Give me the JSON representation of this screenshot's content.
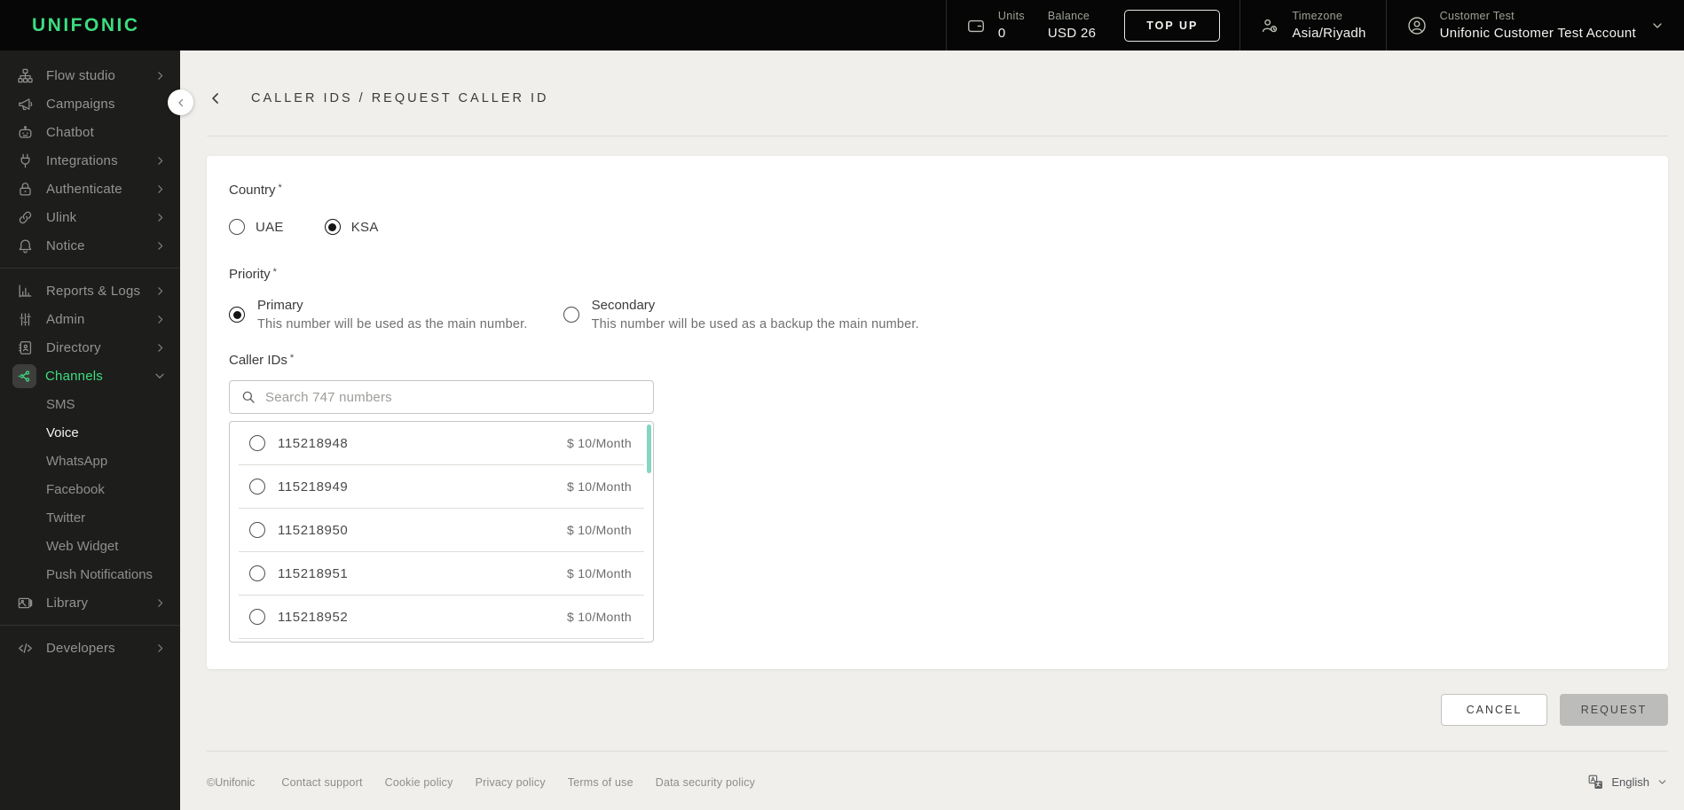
{
  "brand": {
    "logo_text": "UNIFONIC"
  },
  "header": {
    "units": {
      "label": "Units",
      "value": "0"
    },
    "balance": {
      "label": "Balance",
      "value": "USD 26"
    },
    "topup_label": "TOP UP",
    "timezone": {
      "label": "Timezone",
      "value": "Asia/Riyadh"
    },
    "account": {
      "label": "Customer Test",
      "value": "Unifonic Customer Test Account"
    }
  },
  "sidebar": {
    "items": [
      {
        "label": "Flow studio"
      },
      {
        "label": "Campaigns"
      },
      {
        "label": "Chatbot"
      },
      {
        "label": "Integrations"
      },
      {
        "label": "Authenticate"
      },
      {
        "label": "Ulink"
      },
      {
        "label": "Notice"
      },
      {
        "label": "Reports & Logs"
      },
      {
        "label": "Admin"
      },
      {
        "label": "Directory"
      },
      {
        "label": "Channels"
      },
      {
        "label": "Library"
      },
      {
        "label": "Developers"
      }
    ],
    "channels_children": [
      {
        "label": "SMS"
      },
      {
        "label": "Voice"
      },
      {
        "label": "WhatsApp"
      },
      {
        "label": "Facebook"
      },
      {
        "label": "Twitter"
      },
      {
        "label": "Web Widget"
      },
      {
        "label": "Push Notifications"
      }
    ]
  },
  "page": {
    "breadcrumb": "CALLER IDS / REQUEST CALLER ID"
  },
  "form": {
    "country": {
      "label": "Country",
      "required_mark": "*",
      "options": [
        {
          "label": "UAE",
          "selected": false
        },
        {
          "label": "KSA",
          "selected": true
        }
      ]
    },
    "priority": {
      "label": "Priority",
      "required_mark": "*",
      "options": [
        {
          "label": "Primary",
          "description": "This number will be used as the main number.",
          "selected": true
        },
        {
          "label": "Secondary",
          "description": "This number will be used as a backup the main number.",
          "selected": false
        }
      ]
    },
    "caller_ids": {
      "label": "Caller IDs",
      "required_mark": "*",
      "search_placeholder": "Search 747 numbers",
      "numbers": [
        {
          "id": "115218948",
          "price": "$ 10/Month"
        },
        {
          "id": "115218949",
          "price": "$ 10/Month"
        },
        {
          "id": "115218950",
          "price": "$ 10/Month"
        },
        {
          "id": "115218951",
          "price": "$ 10/Month"
        },
        {
          "id": "115218952",
          "price": "$ 10/Month"
        }
      ]
    }
  },
  "actions": {
    "cancel_label": "CANCEL",
    "request_label": "REQUEST"
  },
  "footer": {
    "copyright": "©Unifonic",
    "links": [
      "Contact support",
      "Cookie policy",
      "Privacy policy",
      "Terms of use",
      "Data security policy"
    ],
    "language": "English"
  },
  "colors": {
    "accent_green": "#3ddc7f",
    "scrollbar_thumb": "#84d5c4"
  }
}
